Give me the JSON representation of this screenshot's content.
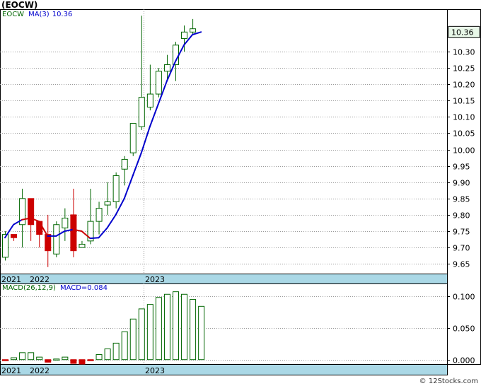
{
  "title": "(EOCW)",
  "price_legend": {
    "symbol": "EOCW",
    "ma_label": "MA(3)",
    "ma_value": "10.36"
  },
  "macd_legend": {
    "label": "MACD(26,12,9)",
    "value_label": "MACD=0.084"
  },
  "current_price_label": "10.36",
  "credit": "© 12Stocks.com",
  "colors": {
    "up": "#006600",
    "down": "#cc0000",
    "ma_up": "#0000cc",
    "ma_down": "#cc0000",
    "axis_band": "#aad8e6",
    "grid": "#999999"
  },
  "chart_data": [
    {
      "type": "candlestick",
      "title": "",
      "x_tick_labels": [
        "2021",
        "2022",
        "2023"
      ],
      "ylim": [
        9.62,
        10.43
      ],
      "y_ticks": [
        9.65,
        9.7,
        9.75,
        9.8,
        9.85,
        9.9,
        9.95,
        10.0,
        10.05,
        10.1,
        10.15,
        10.2,
        10.25,
        10.3
      ],
      "grid": true,
      "candles": [
        {
          "open": 9.67,
          "high": 9.75,
          "low": 9.66,
          "close": 9.74
        },
        {
          "open": 9.74,
          "high": 9.74,
          "low": 9.72,
          "close": 9.73
        },
        {
          "open": 9.77,
          "high": 9.88,
          "low": 9.7,
          "close": 9.85
        },
        {
          "open": 9.85,
          "high": 9.85,
          "low": 9.72,
          "close": 9.77
        },
        {
          "open": 9.78,
          "high": 9.78,
          "low": 9.7,
          "close": 9.74
        },
        {
          "open": 9.74,
          "high": 9.8,
          "low": 9.64,
          "close": 9.69
        },
        {
          "open": 9.68,
          "high": 9.78,
          "low": 9.67,
          "close": 9.77
        },
        {
          "open": 9.76,
          "high": 9.82,
          "low": 9.72,
          "close": 9.79
        },
        {
          "open": 9.8,
          "high": 9.88,
          "low": 9.67,
          "close": 9.69
        },
        {
          "open": 9.7,
          "high": 9.72,
          "low": 9.7,
          "close": 9.71
        },
        {
          "open": 9.72,
          "high": 9.88,
          "low": 9.71,
          "close": 9.78
        },
        {
          "open": 9.78,
          "high": 9.84,
          "low": 9.74,
          "close": 9.82
        },
        {
          "open": 9.83,
          "high": 9.9,
          "low": 9.8,
          "close": 9.84
        },
        {
          "open": 9.84,
          "high": 9.93,
          "low": 9.82,
          "close": 9.92
        },
        {
          "open": 9.94,
          "high": 9.98,
          "low": 9.89,
          "close": 9.97
        },
        {
          "open": 9.99,
          "high": 10.04,
          "low": 9.98,
          "close": 10.08
        },
        {
          "open": 10.07,
          "high": 10.41,
          "low": 10.06,
          "close": 10.16
        },
        {
          "open": 10.13,
          "high": 10.26,
          "low": 10.12,
          "close": 10.17
        },
        {
          "open": 10.17,
          "high": 10.25,
          "low": 10.16,
          "close": 10.24
        },
        {
          "open": 10.24,
          "high": 10.29,
          "low": 10.21,
          "close": 10.26
        },
        {
          "open": 10.26,
          "high": 10.33,
          "low": 10.21,
          "close": 10.32
        },
        {
          "open": 10.34,
          "high": 10.38,
          "low": 10.3,
          "close": 10.36
        },
        {
          "open": 10.36,
          "high": 10.4,
          "low": 10.35,
          "close": 10.37
        }
      ],
      "ma": [
        {
          "value": 9.73,
          "trend": "up"
        },
        {
          "value": 9.77,
          "trend": "up"
        },
        {
          "value": 9.785,
          "trend": "up"
        },
        {
          "value": 9.79,
          "trend": "down"
        },
        {
          "value": 9.78,
          "trend": "down"
        },
        {
          "value": 9.735,
          "trend": "down"
        },
        {
          "value": 9.735,
          "trend": "up"
        },
        {
          "value": 9.75,
          "trend": "up"
        },
        {
          "value": 9.755,
          "trend": "up"
        },
        {
          "value": 9.75,
          "trend": "down"
        },
        {
          "value": 9.728,
          "trend": "down"
        },
        {
          "value": 9.73,
          "trend": "up"
        },
        {
          "value": 9.76,
          "trend": "up"
        },
        {
          "value": 9.8,
          "trend": "up"
        },
        {
          "value": 9.85,
          "trend": "up"
        },
        {
          "value": 9.92,
          "trend": "up"
        },
        {
          "value": 9.99,
          "trend": "up"
        },
        {
          "value": 10.07,
          "trend": "up"
        },
        {
          "value": 10.14,
          "trend": "up"
        },
        {
          "value": 10.21,
          "trend": "up"
        },
        {
          "value": 10.27,
          "trend": "up"
        },
        {
          "value": 10.32,
          "trend": "up"
        },
        {
          "value": 10.352,
          "trend": "up"
        },
        {
          "value": 10.36,
          "trend": "up"
        }
      ]
    },
    {
      "type": "bar",
      "title": "",
      "x_tick_labels": [
        "2021",
        "2022",
        "2023"
      ],
      "ylim": [
        -0.007,
        0.12
      ],
      "y_ticks": [
        0.0,
        0.05,
        0.1
      ],
      "y_tick_labels": [
        "0.000",
        "0.050",
        "0.100"
      ],
      "grid": true,
      "values": [
        -0.001,
        0.003,
        0.011,
        0.011,
        0.004,
        -0.004,
        0.001,
        0.004,
        -0.006,
        -0.007,
        -0.001,
        0.008,
        0.017,
        0.026,
        0.044,
        0.064,
        0.08,
        0.087,
        0.098,
        0.103,
        0.107,
        0.103,
        0.095,
        0.084
      ]
    }
  ]
}
